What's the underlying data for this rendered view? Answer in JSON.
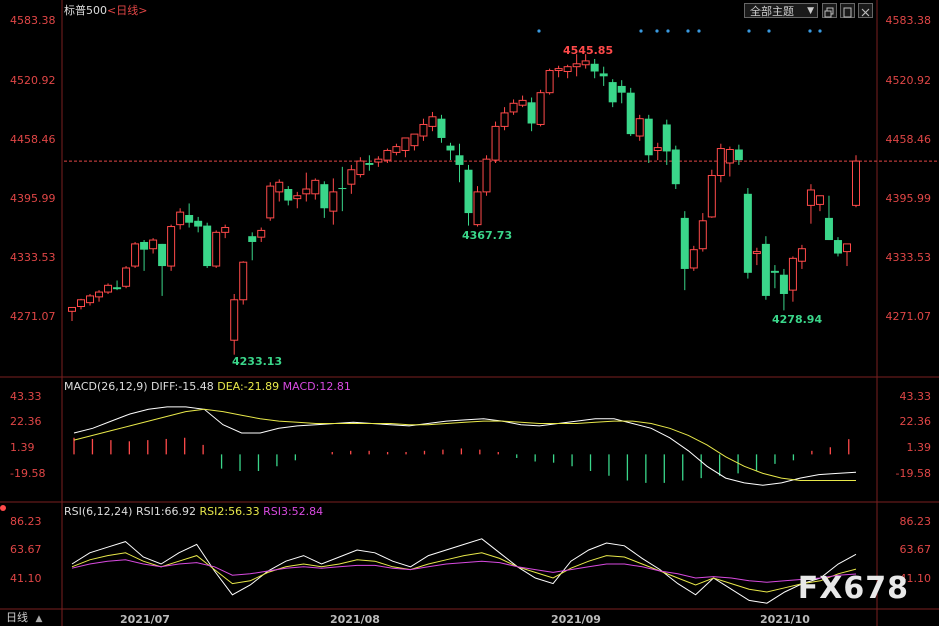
{
  "header": {
    "symbol": "标普500",
    "period": "<日线>",
    "theme_select": "全部主题",
    "icons": [
      "dropdown-arrow-icon",
      "restore-window-icon",
      "maximize-window-icon",
      "close-window-icon"
    ]
  },
  "price_axis": [
    "4583.38",
    "4520.92",
    "4458.46",
    "4395.99",
    "4333.53",
    "4271.07"
  ],
  "price_annotations": {
    "high": "4545.85",
    "low1": "4233.13",
    "low2": "4367.73",
    "low3": "4278.94"
  },
  "macd": {
    "title": "MACD(26,12,9)",
    "diff": "DIFF:-15.48",
    "dea": "DEA:-21.89",
    "macd": "MACD:12.81",
    "axis": [
      "43.33",
      "22.36",
      "1.39",
      "-19.58"
    ]
  },
  "rsi": {
    "title": "RSI(6,12,24)",
    "rsi1": "RSI1:66.92",
    "rsi2": "RSI2:56.33",
    "rsi3": "RSI3:52.84",
    "axis": [
      "86.23",
      "63.67",
      "41.10"
    ]
  },
  "x_axis": [
    "2021/07",
    "2021/08",
    "2021/09",
    "2021/10"
  ],
  "bottom_left": "日线",
  "watermark": "FX678",
  "colors": {
    "up": "#ff4a4a",
    "down": "#3ad68a",
    "diff_line": "#ffffff",
    "dea_line": "#e8e84a",
    "macd_label": "#d84ae0",
    "axis_text": "#e04646",
    "grid": "#7a1f1f"
  },
  "chart_data": [
    {
      "type": "candlestick",
      "title": "标普500 <日线>",
      "ylim": [
        4215,
        4595
      ],
      "candles": [
        {
          "o": 4278,
          "h": 4282,
          "l": 4268,
          "c": 4282
        },
        {
          "o": 4283,
          "h": 4291,
          "l": 4280,
          "c": 4290
        },
        {
          "o": 4287,
          "h": 4296,
          "l": 4284,
          "c": 4294
        },
        {
          "o": 4293,
          "h": 4300,
          "l": 4288,
          "c": 4298
        },
        {
          "o": 4298,
          "h": 4307,
          "l": 4296,
          "c": 4305
        },
        {
          "o": 4303,
          "h": 4310,
          "l": 4300,
          "c": 4301
        },
        {
          "o": 4304,
          "h": 4325,
          "l": 4302,
          "c": 4323
        },
        {
          "o": 4325,
          "h": 4350,
          "l": 4323,
          "c": 4348
        },
        {
          "o": 4350,
          "h": 4352,
          "l": 4320,
          "c": 4342
        },
        {
          "o": 4343,
          "h": 4354,
          "l": 4338,
          "c": 4352
        },
        {
          "o": 4348,
          "h": 4330,
          "l": 4294,
          "c": 4325
        },
        {
          "o": 4325,
          "h": 4368,
          "l": 4320,
          "c": 4366
        },
        {
          "o": 4368,
          "h": 4385,
          "l": 4363,
          "c": 4381
        },
        {
          "o": 4378,
          "h": 4390,
          "l": 4365,
          "c": 4370
        },
        {
          "o": 4372,
          "h": 4376,
          "l": 4360,
          "c": 4366
        },
        {
          "o": 4367,
          "h": 4370,
          "l": 4323,
          "c": 4325
        },
        {
          "o": 4325,
          "h": 4362,
          "l": 4323,
          "c": 4360
        },
        {
          "o": 4360,
          "h": 4368,
          "l": 4354,
          "c": 4365
        },
        {
          "o": 4248,
          "h": 4296,
          "l": 4233,
          "c": 4290
        },
        {
          "o": 4290,
          "h": 4330,
          "l": 4285,
          "c": 4329
        },
        {
          "o": 4356,
          "h": 4360,
          "l": 4331,
          "c": 4350
        },
        {
          "o": 4355,
          "h": 4365,
          "l": 4350,
          "c": 4362
        },
        {
          "o": 4375,
          "h": 4412,
          "l": 4372,
          "c": 4408
        },
        {
          "o": 4402,
          "h": 4415,
          "l": 4392,
          "c": 4412
        },
        {
          "o": 4405,
          "h": 4408,
          "l": 4388,
          "c": 4393
        },
        {
          "o": 4395,
          "h": 4402,
          "l": 4385,
          "c": 4398
        },
        {
          "o": 4400,
          "h": 4422,
          "l": 4392,
          "c": 4405
        },
        {
          "o": 4400,
          "h": 4416,
          "l": 4394,
          "c": 4414
        },
        {
          "o": 4410,
          "h": 4413,
          "l": 4375,
          "c": 4385
        },
        {
          "o": 4382,
          "h": 4416,
          "l": 4368,
          "c": 4402
        },
        {
          "o": 4406,
          "h": 4428,
          "l": 4382,
          "c": 4405
        },
        {
          "o": 4410,
          "h": 4430,
          "l": 4400,
          "c": 4425
        },
        {
          "o": 4420,
          "h": 4438,
          "l": 4417,
          "c": 4434
        },
        {
          "o": 4432,
          "h": 4440,
          "l": 4424,
          "c": 4430
        },
        {
          "o": 4433,
          "h": 4439,
          "l": 4428,
          "c": 4436
        },
        {
          "o": 4435,
          "h": 4447,
          "l": 4432,
          "c": 4445
        },
        {
          "o": 4443,
          "h": 4452,
          "l": 4440,
          "c": 4449
        },
        {
          "o": 4445,
          "h": 4458,
          "l": 4438,
          "c": 4458
        },
        {
          "o": 4450,
          "h": 4462,
          "l": 4445,
          "c": 4462
        },
        {
          "o": 4460,
          "h": 4478,
          "l": 4455,
          "c": 4472
        },
        {
          "o": 4470,
          "h": 4485,
          "l": 4465,
          "c": 4480
        },
        {
          "o": 4478,
          "h": 4482,
          "l": 4453,
          "c": 4458
        },
        {
          "o": 4450,
          "h": 4453,
          "l": 4435,
          "c": 4445
        },
        {
          "o": 4440,
          "h": 4452,
          "l": 4412,
          "c": 4430
        },
        {
          "o": 4425,
          "h": 4430,
          "l": 4367,
          "c": 4380
        },
        {
          "o": 4368,
          "h": 4408,
          "l": 4366,
          "c": 4402
        },
        {
          "o": 4402,
          "h": 4440,
          "l": 4398,
          "c": 4436
        },
        {
          "o": 4435,
          "h": 4475,
          "l": 4432,
          "c": 4470
        },
        {
          "o": 4470,
          "h": 4490,
          "l": 4466,
          "c": 4484
        },
        {
          "o": 4485,
          "h": 4498,
          "l": 4482,
          "c": 4494
        },
        {
          "o": 4492,
          "h": 4502,
          "l": 4490,
          "c": 4497
        },
        {
          "o": 4495,
          "h": 4500,
          "l": 4465,
          "c": 4473
        },
        {
          "o": 4472,
          "h": 4508,
          "l": 4470,
          "c": 4505
        },
        {
          "o": 4505,
          "h": 4530,
          "l": 4503,
          "c": 4528
        },
        {
          "o": 4528,
          "h": 4533,
          "l": 4521,
          "c": 4530
        },
        {
          "o": 4527,
          "h": 4534,
          "l": 4520,
          "c": 4532
        },
        {
          "o": 4532,
          "h": 4545,
          "l": 4522,
          "c": 4535
        },
        {
          "o": 4534,
          "h": 4545,
          "l": 4530,
          "c": 4538
        },
        {
          "o": 4535,
          "h": 4540,
          "l": 4520,
          "c": 4527
        },
        {
          "o": 4525,
          "h": 4532,
          "l": 4512,
          "c": 4522
        },
        {
          "o": 4516,
          "h": 4519,
          "l": 4490,
          "c": 4495
        },
        {
          "o": 4512,
          "h": 4518,
          "l": 4494,
          "c": 4505
        },
        {
          "o": 4505,
          "h": 4510,
          "l": 4460,
          "c": 4462
        },
        {
          "o": 4460,
          "h": 4482,
          "l": 4455,
          "c": 4478
        },
        {
          "o": 4478,
          "h": 4482,
          "l": 4432,
          "c": 4440
        },
        {
          "o": 4445,
          "h": 4453,
          "l": 4435,
          "c": 4448
        },
        {
          "o": 4472,
          "h": 4477,
          "l": 4430,
          "c": 4444
        },
        {
          "o": 4446,
          "h": 4450,
          "l": 4405,
          "c": 4410
        },
        {
          "o": 4375,
          "h": 4382,
          "l": 4300,
          "c": 4322
        },
        {
          "o": 4323,
          "h": 4346,
          "l": 4320,
          "c": 4342
        },
        {
          "o": 4343,
          "h": 4380,
          "l": 4340,
          "c": 4372
        },
        {
          "o": 4376,
          "h": 4425,
          "l": 4375,
          "c": 4419
        },
        {
          "o": 4419,
          "h": 4452,
          "l": 4412,
          "c": 4447
        },
        {
          "o": 4432,
          "h": 4449,
          "l": 4418,
          "c": 4446
        },
        {
          "o": 4446,
          "h": 4451,
          "l": 4430,
          "c": 4435
        },
        {
          "o": 4400,
          "h": 4406,
          "l": 4312,
          "c": 4318
        },
        {
          "o": 4338,
          "h": 4344,
          "l": 4326,
          "c": 4340
        },
        {
          "o": 4348,
          "h": 4356,
          "l": 4290,
          "c": 4294
        },
        {
          "o": 4320,
          "h": 4326,
          "l": 4302,
          "c": 4318
        },
        {
          "o": 4316,
          "h": 4322,
          "l": 4279,
          "c": 4296
        },
        {
          "o": 4300,
          "h": 4335,
          "l": 4288,
          "c": 4333
        },
        {
          "o": 4330,
          "h": 4347,
          "l": 4322,
          "c": 4343
        },
        {
          "o": 4388,
          "h": 4410,
          "l": 4369,
          "c": 4404
        },
        {
          "o": 4389,
          "h": 4398,
          "l": 4382,
          "c": 4398
        },
        {
          "o": 4375,
          "h": 4398,
          "l": 4365,
          "c": 4352
        },
        {
          "o": 4352,
          "h": 4355,
          "l": 4335,
          "c": 4338
        },
        {
          "o": 4340,
          "h": 4345,
          "l": 4325,
          "c": 4348
        },
        {
          "o": 4388,
          "h": 4440,
          "l": 4386,
          "c": 4434
        }
      ],
      "reference_line": 4434
    },
    {
      "type": "line",
      "title": "MACD(26,12,9)",
      "ylim": [
        -30,
        50
      ],
      "series": [
        {
          "name": "DIFF",
          "values": [
            18,
            22,
            28,
            34,
            38,
            40,
            40,
            38,
            25,
            18,
            18,
            22,
            24,
            25,
            26,
            27,
            26,
            25,
            24,
            26,
            28,
            29,
            30,
            28,
            25,
            24,
            26,
            28,
            30,
            30,
            26,
            22,
            14,
            3,
            -10,
            -20,
            -24,
            -26,
            -24,
            -20,
            -17,
            -16,
            -15
          ]
        },
        {
          "name": "DEA",
          "values": [
            12,
            16,
            20,
            24,
            28,
            32,
            36,
            38,
            36,
            33,
            30,
            28,
            27,
            26,
            26,
            26,
            26,
            26,
            25,
            25,
            26,
            27,
            28,
            28,
            27,
            26,
            26,
            26,
            27,
            28,
            28,
            26,
            22,
            16,
            8,
            -2,
            -10,
            -16,
            -20,
            -22,
            -22,
            -22,
            -22
          ]
        }
      ],
      "histogram": [
        14,
        13,
        12,
        11,
        12,
        13,
        14,
        8,
        -12,
        -14,
        -14,
        -10,
        -5,
        0,
        2,
        3,
        3,
        2,
        2,
        3,
        4,
        5,
        4,
        2,
        -3,
        -6,
        -7,
        -10,
        -14,
        -18,
        -22,
        -24,
        -24,
        -22,
        -20,
        -18,
        -16,
        -14,
        -8,
        -5,
        3,
        6,
        12.81
      ]
    },
    {
      "type": "line",
      "title": "RSI(6,12,24)",
      "ylim": [
        30,
        95
      ],
      "series": [
        {
          "name": "RSI1",
          "values": [
            60,
            68,
            72,
            76,
            65,
            60,
            68,
            74,
            55,
            38,
            45,
            55,
            62,
            66,
            60,
            65,
            70,
            68,
            62,
            58,
            66,
            70,
            74,
            78,
            68,
            58,
            50,
            46,
            62,
            70,
            75,
            73,
            64,
            56,
            46,
            38,
            50,
            42,
            34,
            32,
            40,
            46,
            50,
            60,
            66.92
          ]
        },
        {
          "name": "RSI2",
          "values": [
            58,
            63,
            66,
            68,
            62,
            58,
            62,
            66,
            56,
            46,
            48,
            54,
            58,
            60,
            58,
            60,
            63,
            62,
            58,
            56,
            60,
            63,
            66,
            68,
            64,
            58,
            54,
            50,
            57,
            62,
            66,
            65,
            60,
            55,
            50,
            45,
            50,
            46,
            42,
            40,
            43,
            46,
            48,
            53,
            56.33
          ]
        },
        {
          "name": "RSI3",
          "values": [
            57,
            60,
            62,
            63,
            60,
            58,
            60,
            61,
            58,
            52,
            53,
            55,
            57,
            58,
            57,
            58,
            59,
            59,
            57,
            56,
            58,
            60,
            61,
            62,
            61,
            58,
            56,
            54,
            56,
            58,
            60,
            60,
            58,
            55,
            53,
            50,
            51,
            50,
            48,
            47,
            48,
            49,
            50,
            52,
            52.84
          ]
        }
      ]
    }
  ]
}
